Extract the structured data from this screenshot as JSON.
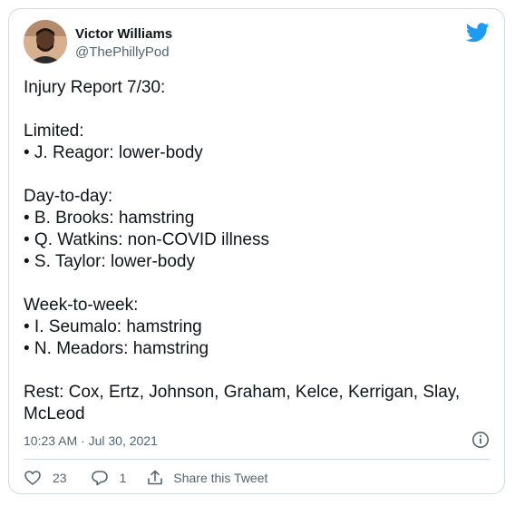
{
  "author": {
    "display_name": "Victor Williams",
    "handle": "@ThePhillyPod"
  },
  "tweet": {
    "text": "Injury Report 7/30:\n\nLimited:\n• J. Reagor: lower-body\n\nDay-to-day:\n• B. Brooks: hamstring\n• Q. Watkins: non-COVID illness\n• S. Taylor: lower-body\n\nWeek-to-week:\n• I. Seumalo: hamstring\n• N. Meadors: hamstring\n\nRest: Cox, Ertz, Johnson, Graham, Kelce, Kerrigan, Slay,\nMcLeod",
    "timestamp": "10:23 AM · Jul 30, 2021"
  },
  "actions": {
    "likes": "23",
    "replies": "1",
    "share_label": "Share this Tweet"
  },
  "icons": {
    "logo": "twitter-bird-icon",
    "info": "info-icon",
    "like": "heart-icon",
    "reply": "reply-icon",
    "share": "share-icon"
  },
  "colors": {
    "brand": "#1d9bf0",
    "text": "#0f1419",
    "secondary": "#536471",
    "border": "#cfd9de"
  }
}
